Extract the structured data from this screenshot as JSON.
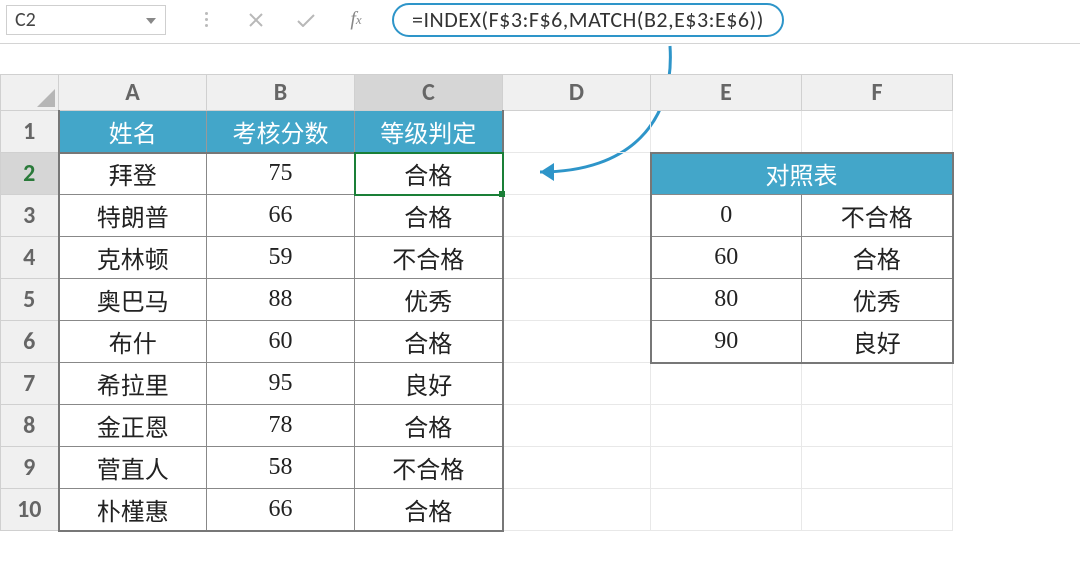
{
  "name_box": "C2",
  "formula": "=INDEX(F$3:F$6,MATCH(B2,E$3:E$6))",
  "columns": [
    "A",
    "B",
    "C",
    "D",
    "E",
    "F"
  ],
  "rows": [
    "1",
    "2",
    "3",
    "4",
    "5",
    "6",
    "7",
    "8",
    "9",
    "10"
  ],
  "selected_cell": "C2",
  "data_headers": {
    "A1": "姓名",
    "B1": "考核分数",
    "C1": "等级判定"
  },
  "data_rows": [
    {
      "name": "拜登",
      "score": "75",
      "grade": "合格"
    },
    {
      "name": "特朗普",
      "score": "66",
      "grade": "合格"
    },
    {
      "name": "克林顿",
      "score": "59",
      "grade": "不合格"
    },
    {
      "name": "奥巴马",
      "score": "88",
      "grade": "优秀"
    },
    {
      "name": "布什",
      "score": "60",
      "grade": "合格"
    },
    {
      "name": "希拉里",
      "score": "95",
      "grade": "良好"
    },
    {
      "name": "金正恩",
      "score": "78",
      "grade": "合格"
    },
    {
      "name": "菅直人",
      "score": "58",
      "grade": "不合格"
    },
    {
      "name": "朴槿惠",
      "score": "66",
      "grade": "合格"
    }
  ],
  "lookup_header": "对照表",
  "lookup_rows": [
    {
      "min": "0",
      "label": "不合格"
    },
    {
      "min": "60",
      "label": "合格"
    },
    {
      "min": "80",
      "label": "优秀"
    },
    {
      "min": "90",
      "label": "良好"
    }
  ]
}
